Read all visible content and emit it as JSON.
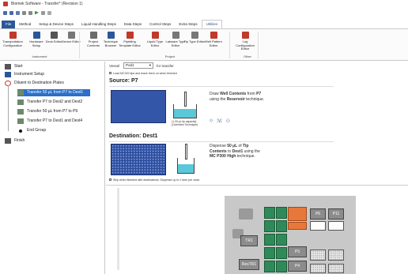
{
  "window": {
    "title": "Biomek Software - Transfer* (Revision 1)"
  },
  "menu_tabs": [
    "File",
    "Method",
    "Setup & Device Steps",
    "Liquid Handling Steps",
    "Data Steps",
    "Control Steps",
    "Extra Steps",
    "Utilities"
  ],
  "ribbon": {
    "buttons": [
      {
        "label": "Transportation Configuration",
        "icon": "transport-icon"
      },
      {
        "label": "Hardware Setup",
        "icon": "hardware-icon"
      },
      {
        "label": "Deck Editor",
        "icon": "deck-icon"
      },
      {
        "label": "Device Editor",
        "icon": "device-icon"
      },
      {
        "label": "Project Contents",
        "icon": "project-icon"
      },
      {
        "label": "Technique Browser",
        "icon": "technique-icon"
      },
      {
        "label": "Pipetting Template Editor",
        "icon": "template-icon"
      },
      {
        "label": "Liquid Type Editor",
        "icon": "liquid-icon"
      },
      {
        "label": "Labware Type Editor",
        "icon": "labware-icon"
      },
      {
        "label": "Tip Type Editor",
        "icon": "tip-icon"
      },
      {
        "label": "Well Pattern Editor",
        "icon": "pattern-icon"
      },
      {
        "label": "Log Configuration Editor",
        "icon": "log-icon"
      }
    ],
    "groups": [
      "Instrument",
      "Project",
      "Other"
    ]
  },
  "steps": [
    {
      "label": "Start",
      "indent": 0
    },
    {
      "label": "Instrument Setup",
      "indent": 0
    },
    {
      "label": "Diluent to Destination Plates",
      "indent": 0
    },
    {
      "label": "Transfer 50 µL from P7 to Dest1",
      "indent": 1,
      "selected": true
    },
    {
      "label": "Transfer P7 to Dest2 and Dest2",
      "indent": 1
    },
    {
      "label": "Transfer 50 µL from P7 to P9",
      "indent": 1
    },
    {
      "label": "Transfer P7 to Dest1 and Dest4",
      "indent": 1
    },
    {
      "label": "End Group",
      "indent": 1
    },
    {
      "label": "Finish",
      "indent": 0
    }
  ],
  "step_config": {
    "head_label": "Vessel",
    "head_value": "Pod1",
    "head_suffix": "for transfer",
    "load_note": "Load MC320 tips and leave them on when finished",
    "source_title": "Source: P7",
    "source_desc_pre": "Draw ",
    "source_desc_bold": "Well Contents",
    "source_desc_mid": " from ",
    "source_desc_bold2": "P7",
    "source_desc_post": " using the ",
    "source_desc_bold3": "Reservoir",
    "source_desc_end": " technique.",
    "source_volume_note": "(1.00 µL tip capacity) (Overrides Technique)",
    "dest_title": "Destination: Dest1",
    "dest_desc_pre": "Dispense ",
    "dest_desc_bold": "50 µL",
    "dest_desc_mid": " of ",
    "dest_desc_bold2": "Tip Contents",
    "dest_desc_mid2": " to ",
    "dest_desc_bold3": "Dest1",
    "dest_desc_mid3": " using the ",
    "dest_desc_bold4": "MC P300 High",
    "dest_desc_end": " technique.",
    "skip_note": "Skip when finished with destinations. Dispense up to 1 time per dose."
  },
  "deck": {
    "slots": [
      {
        "label": "P6",
        "color": "#8c8c8c"
      },
      {
        "label": "P11",
        "color": "#8c8c8c"
      },
      {
        "label": "TR1",
        "color": "#8c8c8c"
      },
      {
        "label": "P3",
        "color": "#8c8c8c"
      },
      {
        "label": "ResTR1",
        "color": "#8c8c8c"
      },
      {
        "label": "P4",
        "color": "#8c8c8c"
      }
    ],
    "accent_green": "#2f8a5a",
    "accent_orange": "#e8783a"
  }
}
